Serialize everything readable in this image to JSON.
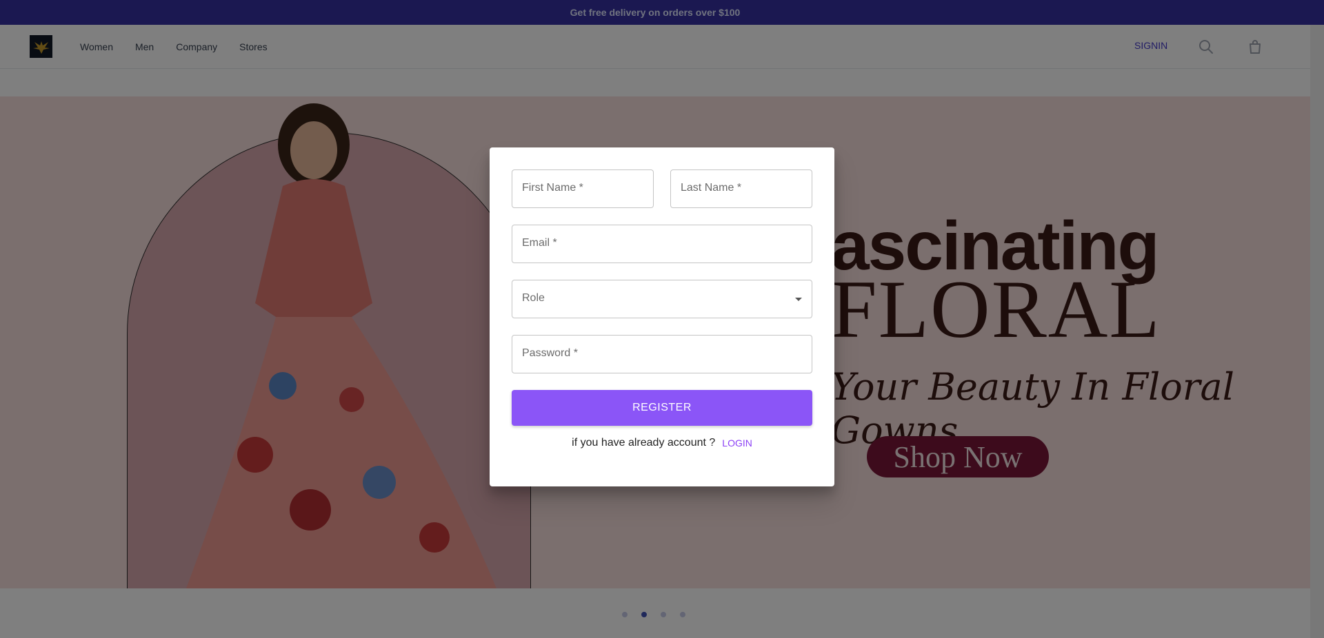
{
  "promo": {
    "text": "Get free delivery on orders over $100"
  },
  "nav": {
    "logo": "brand-logo",
    "links": [
      "Women",
      "Men",
      "Company",
      "Stores"
    ],
    "signin": "SIGNIN",
    "icons": [
      "search-icon",
      "shopping-bag-icon"
    ]
  },
  "hero": {
    "title_line1": "ascinating",
    "title_line2": "FLORAL",
    "subtitle": "Your Beauty In Floral Gowns.",
    "cta": "Shop Now",
    "slides": 4,
    "active_slide": 2
  },
  "modal": {
    "first_name": "First Name *",
    "last_name": "Last Name *",
    "email": "Email *",
    "role": "Role",
    "password": "Password *",
    "register": "REGISTER",
    "footer_text": "if you have already account ?",
    "login": "LOGIN"
  },
  "colors": {
    "promo_bg": "#3730a3",
    "accent": "#8b55f7",
    "signin": "#4338ca",
    "hero_cta": "#7a1638"
  }
}
